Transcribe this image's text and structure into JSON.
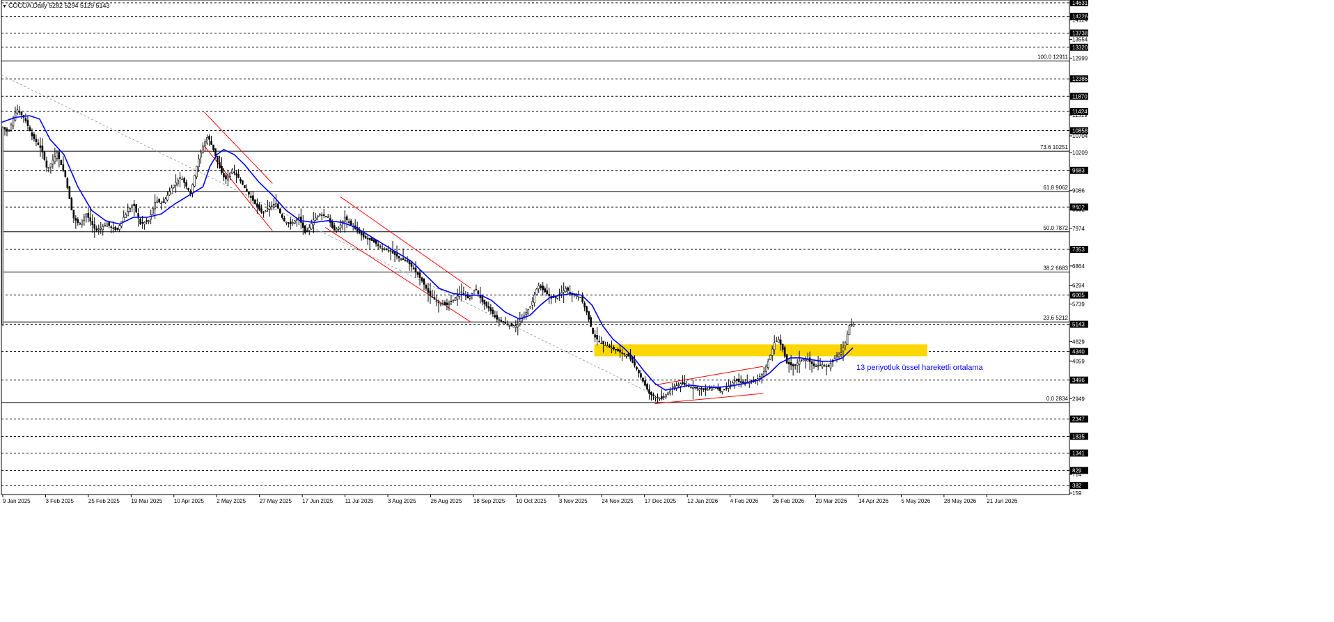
{
  "header": {
    "symbol": "COCOA.Daily",
    "ohlc": "5282 5294 5129 5143"
  },
  "annotation": "13 periyotluk üssel hareketli ortalama",
  "colors": {
    "price": "#000000",
    "ema": "#0000ff",
    "channel": "#ff0000",
    "trendline": "#a0a0a0",
    "zone": "#ffd700",
    "annotation": "#0000ff"
  },
  "chart_data": {
    "type": "candlestick",
    "ylim": [
      159,
      14631
    ],
    "y_ticks": [
      "14631",
      "14226",
      "14124",
      "13738",
      "13554",
      "13320",
      "12999",
      "12386",
      "11870",
      "11424",
      "11319",
      "10858",
      "10704",
      "10209",
      "9683",
      "9086",
      "8602",
      "8532",
      "7974",
      "7353",
      "6864",
      "6294",
      "6005",
      "5739",
      "5143",
      "4629",
      "4340",
      "4059",
      "3496",
      "2949",
      "2347",
      "1835",
      "1341",
      "829",
      "714",
      "382",
      "159"
    ],
    "boxed_levels": [
      14631,
      14226,
      13738,
      13320,
      12386,
      11870,
      11424,
      10858,
      9683,
      8602,
      7353,
      6005,
      5143,
      4340,
      3496,
      2347,
      1835,
      1341,
      829,
      382
    ],
    "fibonacci": [
      {
        "label": "100.0 12911",
        "value": 12911
      },
      {
        "label": "73.6 10251",
        "value": 10251
      },
      {
        "label": "61.8 9062",
        "value": 9062
      },
      {
        "label": "50.0 7872",
        "value": 7872
      },
      {
        "label": "38.2 6683",
        "value": 6683
      },
      {
        "label": "23.6 5212",
        "value": 5212
      },
      {
        "label": "0.0 2834",
        "value": 2834
      }
    ],
    "x_ticks": [
      "9 Jan 2025",
      "3 Feb 2025",
      "25 Feb 2025",
      "19 Mar 2025",
      "10 Apr 2025",
      "2 May 2025",
      "27 May 2025",
      "17 Jun 2025",
      "11 Jul 2025",
      "3 Aug 2025",
      "26 Aug 2025",
      "18 Sep 2025",
      "10 Oct 2025",
      "3 Nov 2025",
      "24 Nov 2025",
      "17 Dec 2025",
      "12 Jan 2026",
      "4 Feb 2026",
      "26 Feb 2026",
      "20 Mar 2026",
      "14 Apr 2026",
      "5 May 2026",
      "28 May 2026",
      "21 Jun 2026"
    ],
    "closes_path": [
      [
        0,
        11000
      ],
      [
        10,
        10800
      ],
      [
        22,
        11500
      ],
      [
        34,
        11200
      ],
      [
        44,
        10700
      ],
      [
        58,
        10300
      ],
      [
        66,
        9700
      ],
      [
        80,
        10200
      ],
      [
        92,
        9500
      ],
      [
        103,
        8300
      ],
      [
        112,
        8100
      ],
      [
        122,
        8400
      ],
      [
        136,
        7900
      ],
      [
        152,
        8100
      ],
      [
        166,
        7900
      ],
      [
        176,
        8300
      ],
      [
        190,
        8700
      ],
      [
        200,
        8100
      ],
      [
        212,
        8200
      ],
      [
        222,
        8800
      ],
      [
        232,
        8700
      ],
      [
        246,
        9200
      ],
      [
        258,
        9500
      ],
      [
        272,
        9000
      ],
      [
        282,
        9900
      ],
      [
        290,
        10400
      ],
      [
        297,
        10700
      ],
      [
        305,
        10300
      ],
      [
        313,
        9800
      ],
      [
        322,
        9400
      ],
      [
        332,
        9700
      ],
      [
        340,
        9500
      ],
      [
        352,
        9100
      ],
      [
        365,
        8700
      ],
      [
        376,
        8400
      ],
      [
        385,
        8600
      ],
      [
        395,
        8700
      ],
      [
        406,
        8200
      ],
      [
        416,
        8100
      ],
      [
        428,
        8300
      ],
      [
        438,
        7800
      ],
      [
        448,
        8200
      ],
      [
        458,
        8400
      ],
      [
        470,
        8300
      ],
      [
        478,
        7900
      ],
      [
        486,
        8000
      ],
      [
        494,
        8300
      ],
      [
        502,
        8100
      ],
      [
        512,
        7900
      ],
      [
        522,
        7700
      ],
      [
        534,
        7600
      ],
      [
        546,
        7400
      ],
      [
        560,
        7300
      ],
      [
        572,
        7100
      ],
      [
        584,
        7000
      ],
      [
        596,
        6700
      ],
      [
        606,
        6400
      ],
      [
        616,
        6000
      ],
      [
        628,
        5800
      ],
      [
        640,
        5700
      ],
      [
        652,
        5900
      ],
      [
        662,
        6100
      ],
      [
        672,
        5900
      ],
      [
        682,
        6200
      ],
      [
        692,
        5800
      ],
      [
        702,
        5600
      ],
      [
        712,
        5300
      ],
      [
        722,
        5200
      ],
      [
        732,
        5100
      ],
      [
        742,
        5100
      ],
      [
        752,
        5400
      ],
      [
        762,
        5700
      ],
      [
        772,
        6300
      ],
      [
        782,
        6100
      ],
      [
        792,
        5900
      ],
      [
        802,
        6000
      ],
      [
        812,
        6200
      ],
      [
        822,
        6000
      ],
      [
        832,
        6000
      ],
      [
        842,
        5500
      ],
      [
        852,
        4800
      ],
      [
        862,
        4600
      ],
      [
        872,
        4500
      ],
      [
        882,
        4400
      ],
      [
        892,
        4300
      ],
      [
        902,
        4200
      ],
      [
        912,
        3900
      ],
      [
        922,
        3500
      ],
      [
        932,
        3100
      ],
      [
        940,
        3000
      ],
      [
        950,
        2950
      ],
      [
        958,
        3100
      ],
      [
        968,
        3300
      ],
      [
        978,
        3400
      ],
      [
        990,
        3300
      ],
      [
        1002,
        3250
      ],
      [
        1014,
        3200
      ],
      [
        1026,
        3300
      ],
      [
        1036,
        3150
      ],
      [
        1046,
        3300
      ],
      [
        1056,
        3500
      ],
      [
        1066,
        3400
      ],
      [
        1076,
        3450
      ],
      [
        1086,
        3500
      ],
      [
        1096,
        3700
      ],
      [
        1104,
        4100
      ],
      [
        1112,
        4600
      ],
      [
        1118,
        4700
      ],
      [
        1124,
        4400
      ],
      [
        1130,
        4000
      ],
      [
        1140,
        3900
      ],
      [
        1150,
        4100
      ],
      [
        1160,
        4100
      ],
      [
        1170,
        3900
      ],
      [
        1180,
        3950
      ],
      [
        1190,
        3900
      ],
      [
        1200,
        4200
      ],
      [
        1208,
        4300
      ],
      [
        1214,
        4600
      ],
      [
        1220,
        5100
      ],
      [
        1226,
        5143
      ]
    ],
    "ema_path": [
      [
        0,
        11100
      ],
      [
        20,
        11250
      ],
      [
        40,
        11300
      ],
      [
        55,
        11200
      ],
      [
        70,
        10600
      ],
      [
        90,
        10150
      ],
      [
        110,
        9200
      ],
      [
        130,
        8500
      ],
      [
        150,
        8200
      ],
      [
        170,
        8100
      ],
      [
        190,
        8300
      ],
      [
        210,
        8300
      ],
      [
        230,
        8400
      ],
      [
        250,
        8700
      ],
      [
        270,
        8950
      ],
      [
        290,
        9200
      ],
      [
        300,
        9800
      ],
      [
        310,
        10150
      ],
      [
        320,
        10300
      ],
      [
        335,
        10150
      ],
      [
        350,
        9850
      ],
      [
        370,
        9350
      ],
      [
        390,
        8950
      ],
      [
        410,
        8500
      ],
      [
        430,
        8200
      ],
      [
        450,
        8150
      ],
      [
        470,
        8200
      ],
      [
        490,
        8150
      ],
      [
        510,
        8000
      ],
      [
        530,
        7750
      ],
      [
        550,
        7500
      ],
      [
        570,
        7250
      ],
      [
        590,
        7000
      ],
      [
        610,
        6600
      ],
      [
        630,
        6200
      ],
      [
        650,
        6050
      ],
      [
        670,
        6000
      ],
      [
        690,
        6000
      ],
      [
        705,
        5850
      ],
      [
        725,
        5500
      ],
      [
        745,
        5300
      ],
      [
        760,
        5400
      ],
      [
        775,
        5700
      ],
      [
        790,
        5950
      ],
      [
        805,
        6000
      ],
      [
        820,
        6050
      ],
      [
        835,
        6000
      ],
      [
        850,
        5700
      ],
      [
        865,
        5100
      ],
      [
        880,
        4700
      ],
      [
        895,
        4450
      ],
      [
        910,
        4150
      ],
      [
        925,
        3750
      ],
      [
        940,
        3400
      ],
      [
        955,
        3200
      ],
      [
        970,
        3250
      ],
      [
        990,
        3350
      ],
      [
        1010,
        3300
      ],
      [
        1030,
        3280
      ],
      [
        1050,
        3320
      ],
      [
        1070,
        3400
      ],
      [
        1090,
        3500
      ],
      [
        1105,
        3700
      ],
      [
        1120,
        4000
      ],
      [
        1135,
        4150
      ],
      [
        1150,
        4150
      ],
      [
        1165,
        4100
      ],
      [
        1180,
        4050
      ],
      [
        1195,
        4050
      ],
      [
        1210,
        4150
      ],
      [
        1225,
        4450
      ]
    ],
    "overlays": [
      {
        "kind": "trendline",
        "from": [
          0,
          12500
        ],
        "to": [
          955,
          2900
        ]
      },
      {
        "kind": "channel",
        "lines": [
          {
            "from": [
              292,
              11400
            ],
            "to": [
              390,
              9300
            ]
          },
          {
            "from": [
              292,
              10400
            ],
            "to": [
              390,
              7900
            ]
          },
          {
            "from": [
              488,
              8900
            ],
            "to": [
              676,
              6200
            ]
          },
          {
            "from": [
              466,
              8000
            ],
            "to": [
              676,
              5200
            ]
          },
          {
            "from": [
              940,
              3350
            ],
            "to": [
              1096,
              3900
            ]
          },
          {
            "from": [
              940,
              2800
            ],
            "to": [
              1096,
              3100
            ]
          }
        ]
      },
      {
        "kind": "zone",
        "x_range": [
          853,
          1332
        ],
        "y_range": [
          4200,
          4550
        ]
      }
    ]
  }
}
